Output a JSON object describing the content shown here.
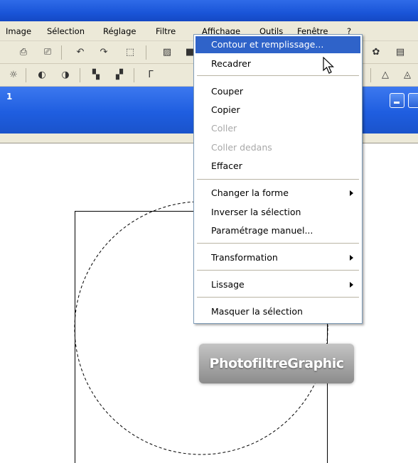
{
  "menubar": {
    "image": "Image",
    "selection": "Sélection",
    "reglage": "Réglage",
    "filtre": "Filtre",
    "affichage": "Affichage",
    "outils": "Outils",
    "fenetre": "Fenêtre",
    "help": "?"
  },
  "document": {
    "number": "1"
  },
  "dropdown": {
    "items": [
      {
        "label": "Contour et remplissage...",
        "state": "highlighted"
      },
      {
        "label": "Recadrer",
        "state": "enabled"
      },
      {
        "label": "Couper",
        "state": "enabled"
      },
      {
        "label": "Copier",
        "state": "enabled"
      },
      {
        "label": "Coller",
        "state": "disabled"
      },
      {
        "label": "Coller dedans",
        "state": "disabled"
      },
      {
        "label": "Effacer",
        "state": "enabled"
      },
      {
        "label": "Changer la forme",
        "state": "enabled",
        "submenu": true
      },
      {
        "label": "Inverser la sélection",
        "state": "enabled"
      },
      {
        "label": "Paramétrage manuel...",
        "state": "enabled"
      },
      {
        "label": "Transformation",
        "state": "enabled",
        "submenu": true
      },
      {
        "label": "Lissage",
        "state": "enabled",
        "submenu": true
      },
      {
        "label": "Masquer la sélection",
        "state": "enabled"
      }
    ]
  },
  "watermark": {
    "text": "PhotofiltreGraphic"
  },
  "colors": {
    "highlight": "#2f63c9",
    "menu_bg": "#ece9d8",
    "titlebar": "#1f5ee0"
  }
}
